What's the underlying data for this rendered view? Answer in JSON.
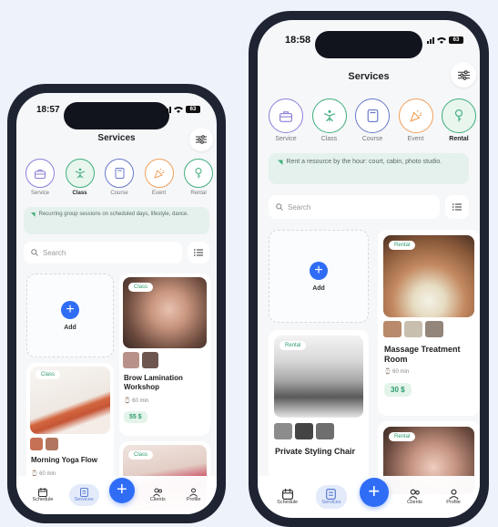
{
  "left": {
    "time": "18:57",
    "title": "Services",
    "categories": [
      {
        "label": "Service",
        "icon": "briefcase-icon",
        "color": "#8b7fd9"
      },
      {
        "label": "Class",
        "icon": "yoga-icon",
        "color": "#3fae7c"
      },
      {
        "label": "Course",
        "icon": "book-icon",
        "color": "#6a78c9"
      },
      {
        "label": "Event",
        "icon": "party-icon",
        "color": "#f0a05a"
      },
      {
        "label": "Rental",
        "icon": "key-icon",
        "color": "#3fae7c"
      }
    ],
    "info_text": "Recurring group sessions on scheduled days, lifestyle, dance.",
    "search_placeholder": "Search",
    "add_label": "Add",
    "cards": [
      {
        "tag": "Class",
        "title": "Brow Lamination Workshop",
        "meta": "⌚ 60 min",
        "price": "55 $"
      },
      {
        "tag": "Class",
        "title": "Morning Yoga Flow",
        "meta": "⌚ 60 min"
      },
      {
        "tag": "Class"
      }
    ],
    "tabs": [
      "Schedule",
      "Services",
      "Clients",
      "Profile"
    ]
  },
  "right": {
    "time": "18:58",
    "title": "Services",
    "categories": [
      {
        "label": "Service",
        "icon": "briefcase-icon",
        "color": "#8b7fd9"
      },
      {
        "label": "Class",
        "icon": "yoga-icon",
        "color": "#3fae7c"
      },
      {
        "label": "Course",
        "icon": "book-icon",
        "color": "#6a78c9"
      },
      {
        "label": "Event",
        "icon": "party-icon",
        "color": "#f0a05a"
      },
      {
        "label": "Rental",
        "icon": "key-icon",
        "color": "#3fae7c"
      }
    ],
    "info_text": "Rent a resource by the hour: court, cabin, photo studio.",
    "search_placeholder": "Search",
    "add_label": "Add",
    "cards": [
      {
        "tag": "Rental",
        "title": "Massage Treatment Room",
        "meta": "⌚ 60 min",
        "price": "30 $"
      },
      {
        "tag": "Rental",
        "title": "Private Styling Chair"
      },
      {
        "tag": "Rental"
      }
    ],
    "tabs": [
      "Schedule",
      "Services",
      "Clients",
      "Profile"
    ]
  }
}
